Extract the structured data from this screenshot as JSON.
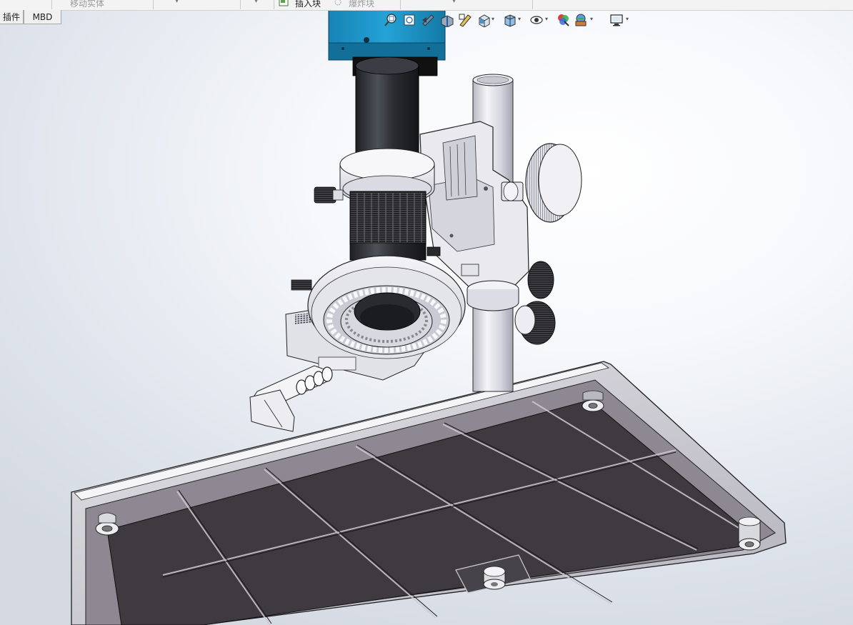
{
  "commandmanager": {
    "item1_label": "移动实体",
    "item2_label": "插入块",
    "item3_label": "爆炸块"
  },
  "tabs": [
    {
      "label": "插件"
    },
    {
      "label": "MBD"
    }
  ],
  "view_toolbar": {
    "icons": [
      "zoom-to-fit-icon",
      "zoom-to-area-icon",
      "previous-view-icon",
      "section-view-icon",
      "dynamic-annotation-icon",
      "view-orientation-icon",
      "display-style-icon",
      "hide-show-items-icon",
      "edit-appearance-icon",
      "apply-scene-icon",
      "view-settings-icon"
    ]
  },
  "model": {
    "name": "stereo-microscope-assembly",
    "parts": [
      "camera",
      "objective-lens",
      "ring-light",
      "column",
      "focus-knob",
      "base-plate",
      "rubber-feet"
    ]
  },
  "colors": {
    "camera_body": "#1b91c4",
    "lens": "#2b2e33",
    "metal": "#dcdde8",
    "base_tile": "#3f3b40",
    "background_light": "#ffffff",
    "background_dark": "#d4d9e2"
  }
}
